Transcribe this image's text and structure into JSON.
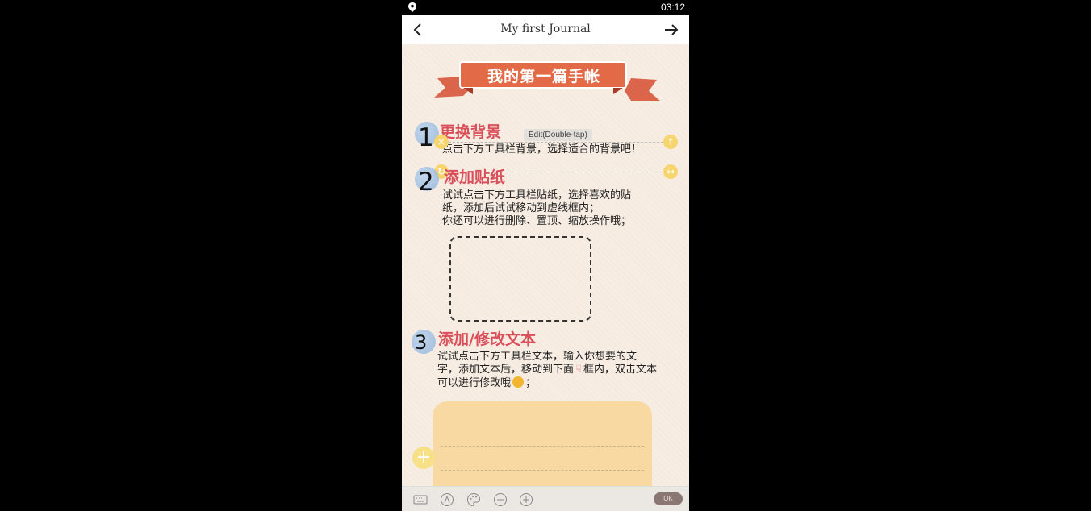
{
  "status_bar": {
    "time": "03:12",
    "location_icon": "location-pin-icon"
  },
  "header": {
    "title": "My first Journal",
    "back_icon": "chevron-left-icon",
    "forward_icon": "arrow-right-icon"
  },
  "banner": {
    "text": "我的第一篇手帐",
    "color": "#e0603f"
  },
  "steps": [
    {
      "number": "1",
      "title": "更换背景",
      "text": "点击下方工具栏背景，选择适合的背景吧！"
    },
    {
      "number": "2",
      "title": "添加贴纸",
      "lines": [
        "试试点击下方工具栏贴纸，选择喜欢的贴",
        "纸，添加后试试移动到虚线框内；",
        "你还可以进行删除、置顶、缩放操作哦；"
      ]
    },
    {
      "number": "3",
      "title": "添加/修改文本",
      "lines": [
        "试试点击下方工具栏文本，输入你想要的文",
        "字，添加文本后，移动到下面",
        "框内，双击文本",
        "可以进行修改哦",
        "；"
      ]
    }
  ],
  "tooltip": "Edit(Double-tap)",
  "toolbar": {
    "icons": [
      "keyboard-icon",
      "font-icon",
      "palette-icon",
      "zoom-out-icon",
      "zoom-in-icon"
    ],
    "ok_label": "OK"
  },
  "colors": {
    "accent_title": "#d94f5a",
    "note_fill": "#f8d9a2",
    "handle": "#f6d56e"
  }
}
